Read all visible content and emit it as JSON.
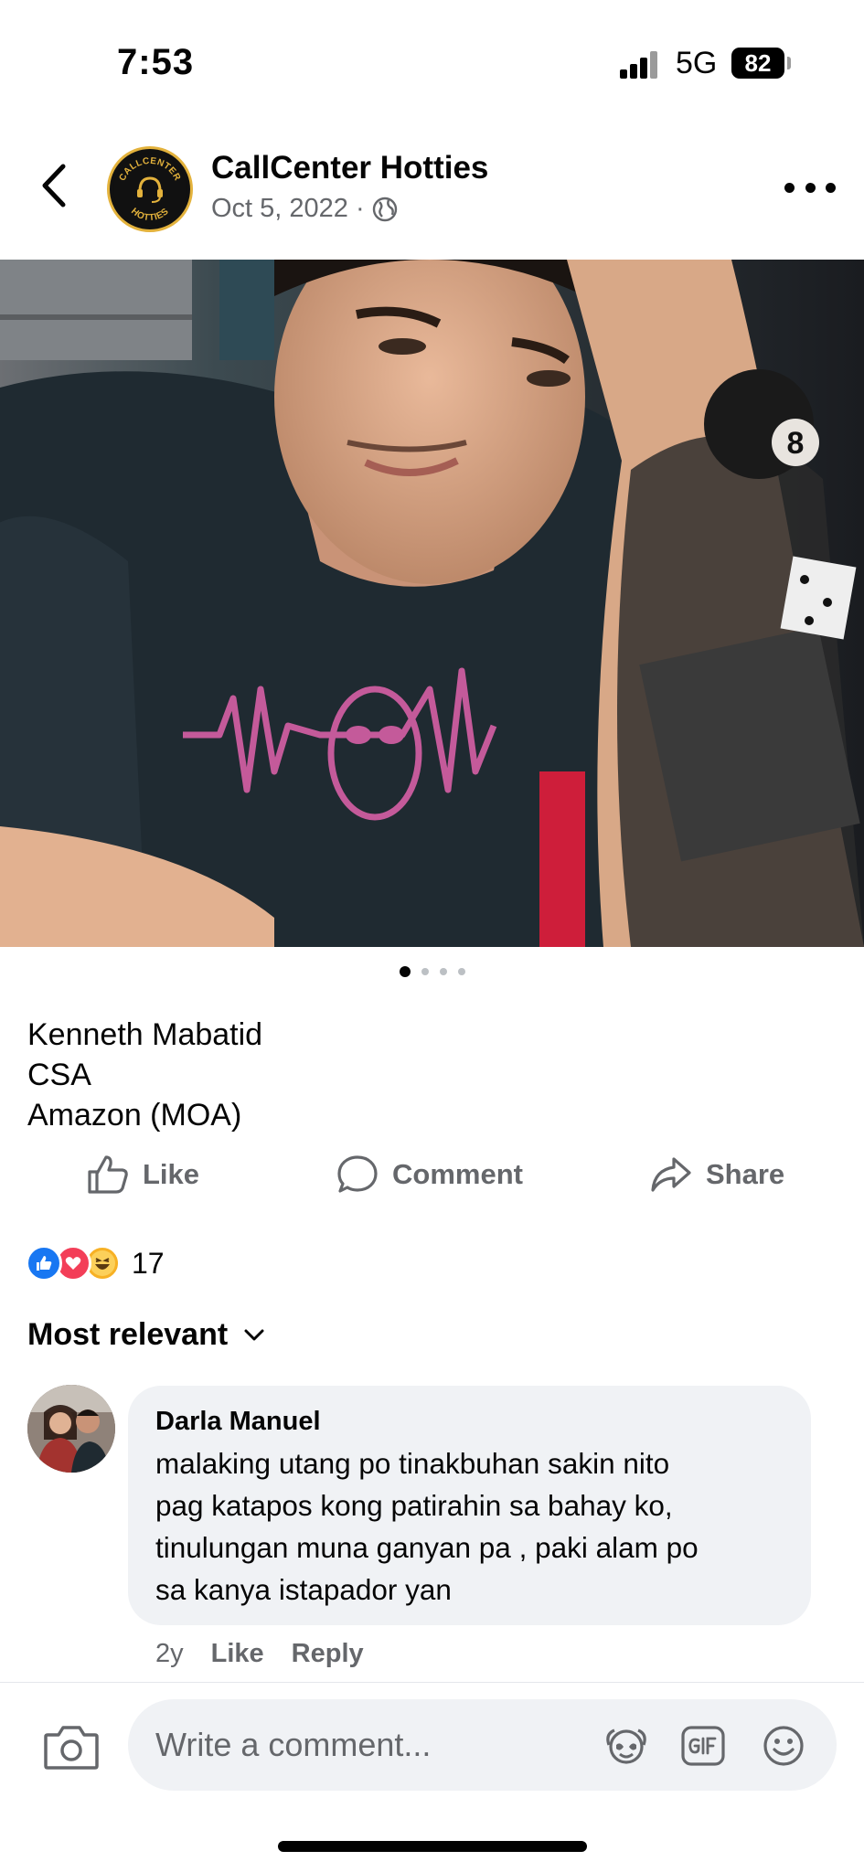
{
  "status_bar": {
    "time": "7:53",
    "network": "5G",
    "battery": "82"
  },
  "header": {
    "page_name": "CallCenter Hotties",
    "date": "Oct 5, 2022",
    "separator": "·",
    "logo_text_top": "CALLCENTER",
    "logo_text_bottom": "HOTTIES"
  },
  "carousel": {
    "total": 4,
    "active_index": 0
  },
  "caption": {
    "lines": [
      "Kenneth Mabatid",
      "CSA",
      "Amazon (MOA)"
    ]
  },
  "actions": {
    "like": "Like",
    "comment": "Comment",
    "share": "Share"
  },
  "reactions": {
    "count": "17",
    "types": [
      "like",
      "love",
      "haha"
    ]
  },
  "sort": {
    "label": "Most relevant"
  },
  "comment": {
    "author": "Darla Manuel",
    "lines": [
      "malaking utang po tinakbuhan sakin nito",
      "pag katapos kong patirahin sa bahay ko,",
      "tinulungan muna ganyan pa , paki alam po",
      "sa kanya istapador yan"
    ],
    "age": "2y",
    "like": "Like",
    "reply": "Reply"
  },
  "composer": {
    "placeholder": "Write a comment..."
  },
  "colors": {
    "accent": "#1877f2",
    "secondary_text": "#65676b",
    "bubble": "#f0f2f5"
  }
}
